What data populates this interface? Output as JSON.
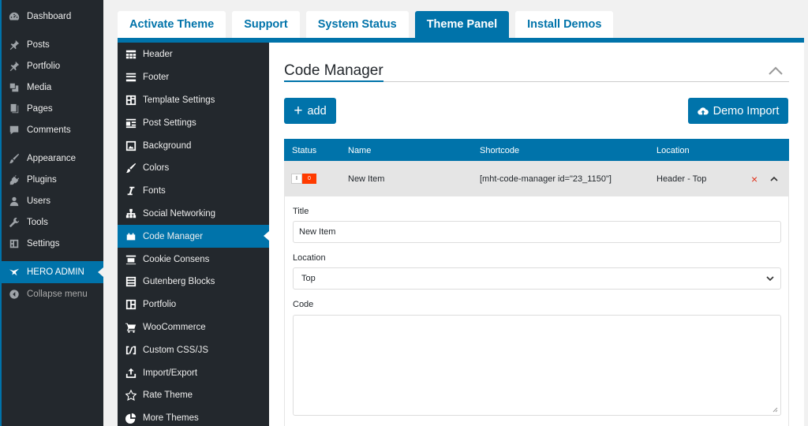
{
  "wp_menu": {
    "items": [
      {
        "label": "Dashboard",
        "icon": "dashboard-icon"
      },
      {
        "label": "Posts",
        "icon": "pin-icon"
      },
      {
        "label": "Portfolio",
        "icon": "pin-icon"
      },
      {
        "label": "Media",
        "icon": "media-icon"
      },
      {
        "label": "Pages",
        "icon": "pages-icon"
      },
      {
        "label": "Comments",
        "icon": "comments-icon"
      },
      {
        "label": "Appearance",
        "icon": "brush-icon"
      },
      {
        "label": "Plugins",
        "icon": "plug-icon"
      },
      {
        "label": "Users",
        "icon": "users-icon"
      },
      {
        "label": "Tools",
        "icon": "wrench-icon"
      },
      {
        "label": "Settings",
        "icon": "settings-icon"
      },
      {
        "label": "HERO ADMIN",
        "icon": "hero-bird-icon"
      },
      {
        "label": "Collapse menu",
        "icon": "collapse-icon"
      }
    ]
  },
  "tabs": [
    {
      "label": "Activate Theme"
    },
    {
      "label": "Support"
    },
    {
      "label": "System Status"
    },
    {
      "label": "Theme Panel"
    },
    {
      "label": "Install Demos"
    }
  ],
  "panel_nav": {
    "items": [
      {
        "label": "Header",
        "icon": "header-icon"
      },
      {
        "label": "Footer",
        "icon": "footer-icon"
      },
      {
        "label": "Template Settings",
        "icon": "template-icon"
      },
      {
        "label": "Post Settings",
        "icon": "post-settings-icon"
      },
      {
        "label": "Background",
        "icon": "image-icon"
      },
      {
        "label": "Colors",
        "icon": "paint-icon"
      },
      {
        "label": "Fonts",
        "icon": "italic-icon"
      },
      {
        "label": "Social Networking",
        "icon": "network-icon"
      },
      {
        "label": "Code Manager",
        "icon": "code-manager-icon"
      },
      {
        "label": "Cookie Consens",
        "icon": "cookie-icon"
      },
      {
        "label": "Gutenberg Blocks",
        "icon": "blocks-icon"
      },
      {
        "label": "Portfolio",
        "icon": "portfolio-icon"
      },
      {
        "label": "WooCommerce",
        "icon": "cart-icon"
      },
      {
        "label": "Custom CSS/JS",
        "icon": "code-icon"
      },
      {
        "label": "Import/Export",
        "icon": "upload-icon"
      },
      {
        "label": "Rate Theme",
        "icon": "star-icon"
      },
      {
        "label": "More Themes",
        "icon": "pie-icon"
      }
    ]
  },
  "main": {
    "section_title": "Code Manager",
    "add_label": "add",
    "add_prefix": "+",
    "demo_import_label": "Demo Import",
    "table": {
      "headers": {
        "status": "Status",
        "name": "Name",
        "shortcode": "Shortcode",
        "location": "Location"
      },
      "row": {
        "status_left": "I",
        "status_right": "0",
        "name": "New Item",
        "shortcode": "[mht-code-manager id=\"23_1150\"]",
        "location": "Header - Top",
        "delete": "×"
      }
    },
    "form": {
      "title_label": "Title",
      "title_value": "New Item",
      "location_label": "Location",
      "location_value": "Top",
      "code_label": "Code",
      "code_value": ""
    }
  },
  "colors": {
    "accent": "#0073aa",
    "wp_dark": "#23282d",
    "danger": "#e0311a",
    "toggle_off": "#ff3b00"
  }
}
